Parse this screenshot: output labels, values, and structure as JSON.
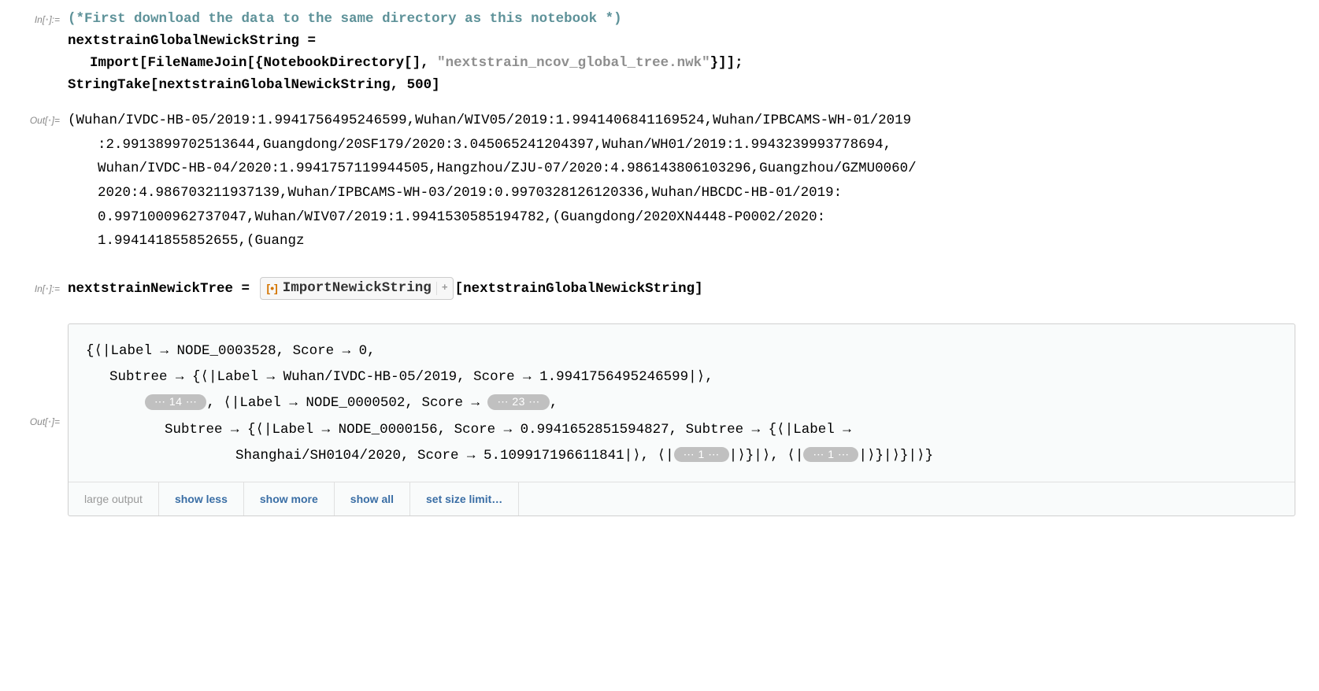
{
  "labels": {
    "in": "In[",
    "out": "Out[",
    "in_suffix": "]:=",
    "out_suffix": "]="
  },
  "cell1": {
    "comment": "(*First download the data to the same directory as this notebook *)",
    "line2_a": "nextstrainGlobalNewickString =",
    "line3_a": "Import[FileNameJoin[{NotebookDirectory[], ",
    "line3_str": "\"nextstrain_ncov_global_tree.nwk\"",
    "line3_b": "}]];",
    "line4": "StringTake[nextstrainGlobalNewickString, 500]"
  },
  "out1": {
    "l1": "(Wuhan/IVDC-HB-05/2019:1.9941756495246599,Wuhan/WIV05/2019:1.9941406841169524,Wuhan/IPBCAMS-WH-01/2019",
    "l2": ":2.9913899702513644,Guangdong/20SF179/2020:3.045065241204397,Wuhan/WH01/2019:1.9943239993778694,",
    "l3": "Wuhan/IVDC-HB-04/2020:1.9941757119944505,Hangzhou/ZJU-07/2020:4.986143806103296,Guangzhou/GZMU0060/",
    "l4": "2020:4.986703211937139,Wuhan/IPBCAMS-WH-03/2019:0.9970328126120336,Wuhan/HBCDC-HB-01/2019:",
    "l5": "0.9971000962737047,Wuhan/WIV07/2019:1.9941530585194782,(Guangdong/2020XN4448-P0002/2020:",
    "l6": "1.994141855852655,(Guangz"
  },
  "cell2": {
    "pre": "nextstrainNewickTree = ",
    "fn": "ImportNewickString",
    "post": "[nextstrainGlobalNewickString]"
  },
  "out2": {
    "l1_a": "{⟨|Label → NODE_0003528, Score → 0,",
    "l2_a": "Subtree → {⟨|Label → Wuhan/IVDC-HB-05/2019, Score → 1.9941756495246599|⟩,",
    "pill14": "⋯ 14 ⋯",
    "l3_b": ", ⟨|Label → NODE_0000502, Score → ",
    "pill23": "⋯ 23 ⋯",
    "l3_c": ",",
    "l4_a": "Subtree → {⟨|Label → NODE_0000156, Score → 0.9941652851594827, Subtree → {⟨|Label →",
    "l5_a": "Shanghai/SH0104/2020, Score → 5.109917196611841|⟩, ⟨|",
    "pill1": "⋯ 1 ⋯",
    "l5_b": "|⟩}|⟩, ⟨|",
    "l5_c": "|⟩}|⟩}|⟩}"
  },
  "footer": {
    "large": "large output",
    "less": "show less",
    "more": "show more",
    "all": "show all",
    "limit": "set size limit…"
  }
}
